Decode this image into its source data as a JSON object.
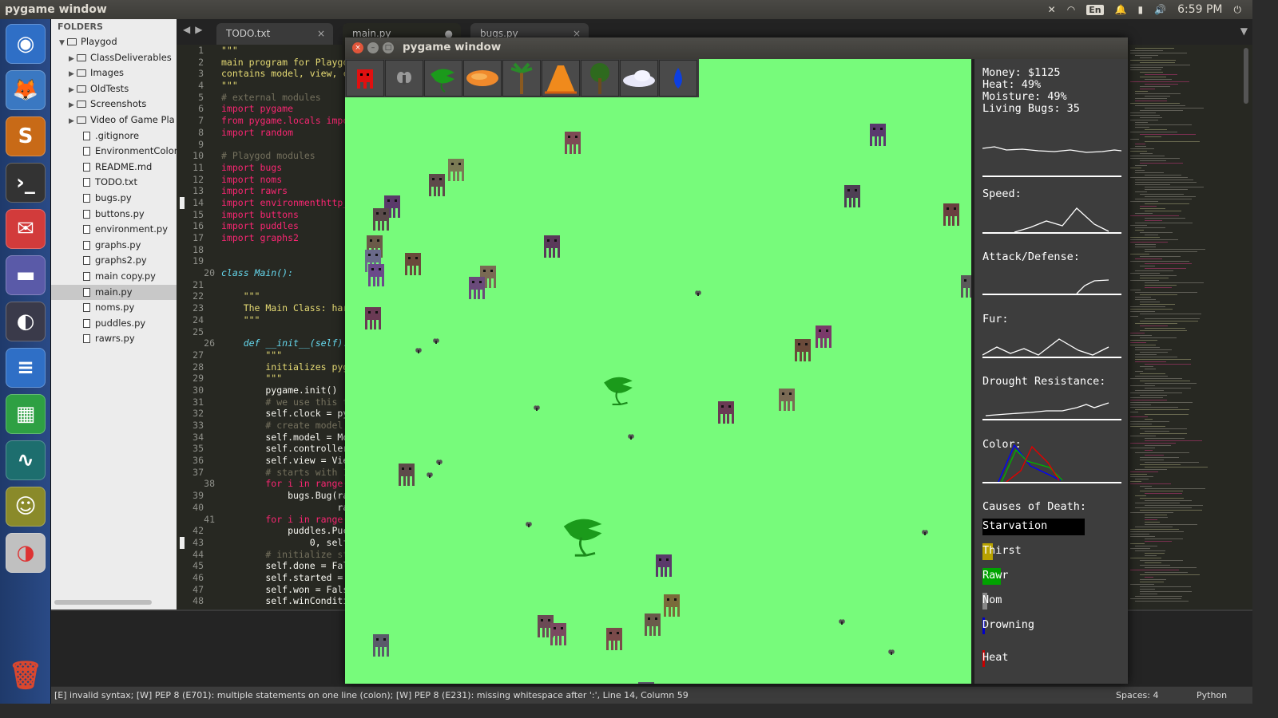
{
  "top_panel": {
    "title": "pygame window",
    "keyboard_layout": "En",
    "clock": "6:59 PM"
  },
  "launcher": {
    "apps": [
      "ubuntu-dash",
      "firefox",
      "sublime-text",
      "terminal",
      "email-client",
      "music-player",
      "image-viewer",
      "text-editor",
      "spreadsheet",
      "system-monitor",
      "game",
      "disk-usage",
      "trash"
    ]
  },
  "sidebar": {
    "header": "FOLDERS",
    "root": "Playgod",
    "folders": [
      "ClassDeliverables",
      "Images",
      "OldTests",
      "Screenshots",
      "Video of Game Pla"
    ],
    "files": [
      ".gitignore",
      "EnvironmentColor",
      "README.md",
      "TODO.txt",
      "bugs.py",
      "buttons.py",
      "environment.py",
      "graphs.py",
      "graphs2.py",
      "main copy.py",
      "main.py",
      "noms.py",
      "puddles.py",
      "rawrs.py"
    ],
    "active_file": "main.py"
  },
  "tabs": [
    {
      "label": "TODO.txt",
      "close": "×"
    },
    {
      "label": "main.py",
      "close": "●"
    },
    {
      "label": "bugs.py",
      "close": "×"
    }
  ],
  "editor": {
    "line_numbers": [
      "1",
      "2",
      "3",
      "4",
      "5",
      "6",
      "7",
      "8",
      "9",
      "10",
      "11",
      "12",
      "13",
      "14",
      "15",
      "16",
      "17",
      "18",
      "19",
      "20",
      "21",
      "22",
      "23",
      "24",
      "25",
      "26",
      "27",
      "28",
      "29",
      "30",
      "31",
      "32",
      "33",
      "34",
      "35",
      "36",
      "37",
      "38",
      "39",
      "40",
      "41",
      "42",
      "43",
      "44",
      "45",
      "46",
      "47",
      "48"
    ],
    "lines": [
      "\"\"\"",
      "main program for Playgo",
      "contains model, view, c",
      "\"\"\"",
      "# external modules",
      "import pygame",
      "from pygame.locals impo",
      "import random",
      "",
      "# Playgod modules",
      "import bugs",
      "import noms",
      "import rawrs",
      "import environmenthttp_",
      "import buttons",
      "import puddles",
      "import graphs2",
      "",
      "",
      "class Main():",
      "",
      "    \"\"\"",
      "    The Main Class: har",
      "    \"\"\"",
      "",
      "    def __init__(self):",
      "        \"\"\"",
      "        initializes pyg",
      "        \"\"\"",
      "        pygame.init()",
      "        # we use this t",
      "        self.clock = py",
      "        # create model,",
      "        self.model = Mo",
      "        self.controller",
      "        self.view = Vie",
      "        # starts with 1",
      "        for i in range(",
      "            bugs.Bug(ra",
      "                     ra",
      "        for i in range(",
      "            puddles.Puc",
      "                0, self",
      "        # initialize st",
      "        self.done = Fal",
      "        self.started =",
      "        self.won = Fals",
      "        self.winConditi"
    ]
  },
  "status_bar": {
    "message": "[E] invalid syntax; [W] PEP 8 (E701): multiple statements on one line (colon); [W] PEP 8 (E231): missing whitespace after ':', Line 14, Column 59",
    "spaces": "Spaces: 4",
    "language": "Python"
  },
  "pygame": {
    "window_title": "pygame window",
    "tools": [
      "red-bug-tool",
      "fly-tool",
      "rawr-plant-tool",
      "heat-tool",
      "palm-tree-tool",
      "volcano-tool",
      "tree-tool",
      "cloud-tool",
      "water-drop-tool"
    ],
    "stats": {
      "money": "Money: $1125",
      "heat": "Heat: 49%",
      "moisture": "Moisture: 49%",
      "living_bugs": "Living Bugs: 35"
    },
    "graph_labels": [
      "Speed:",
      "Attack/Defense:",
      "Fur:",
      "Drought Resistance:",
      "Color:"
    ],
    "causes_title": "Causes of Death:",
    "causes": [
      {
        "label": "Starvation",
        "color": "#000000",
        "fraction": 1.0
      },
      {
        "label": "Thirst",
        "color": "#b8a200",
        "fraction": 0.1
      },
      {
        "label": "Rawr",
        "color": "#00a300",
        "fraction": 0.18
      },
      {
        "label": "Nom",
        "color": "#888888",
        "fraction": 0.05
      },
      {
        "label": "Drowning",
        "color": "#0000c8",
        "fraction": 0.02
      },
      {
        "label": "Heat",
        "color": "#c80000",
        "fraction": 0.02
      }
    ],
    "colors": {
      "field": "#77fb7b",
      "panel": "#3d3d3d"
    }
  }
}
